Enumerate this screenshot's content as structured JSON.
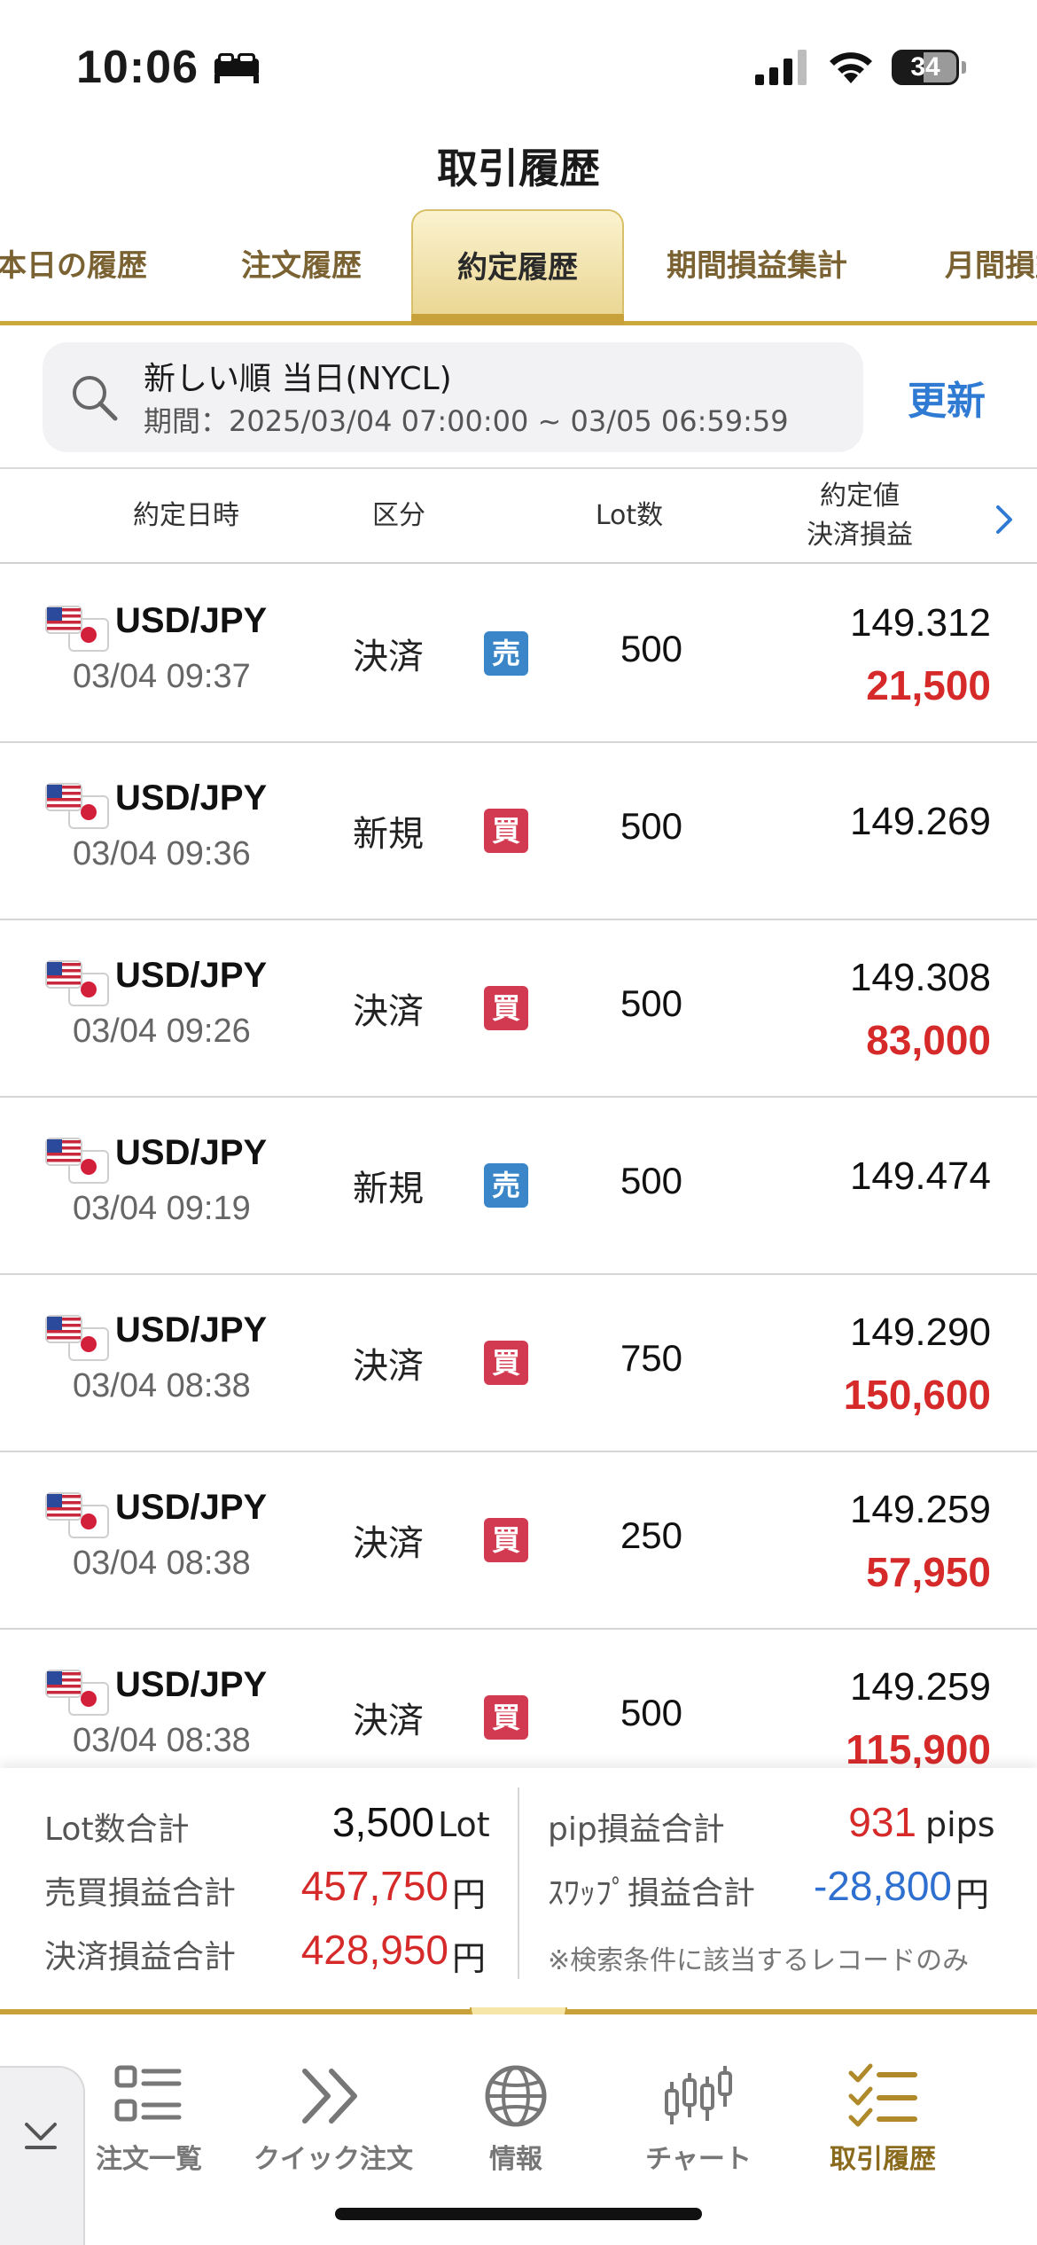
{
  "status_bar": {
    "time": "10:06",
    "battery": "34"
  },
  "page_title": "取引履歴",
  "tabs": [
    {
      "label": "本日の履歴",
      "active": false
    },
    {
      "label": "注文履歴",
      "active": false
    },
    {
      "label": "約定履歴",
      "active": true
    },
    {
      "label": "期間損益集計",
      "active": false
    },
    {
      "label": "月間損益",
      "active": false
    }
  ],
  "search": {
    "line1": "新しい順 当日(NYCL)",
    "line2": "期間：2025/03/04 07:00:00 ~ 03/05 06:59:59",
    "refresh_label": "更新"
  },
  "table": {
    "headers": {
      "datetime": "約定日時",
      "kind": "区分",
      "lot": "Lot数",
      "price_line1": "約定値",
      "price_line2": "決済損益"
    },
    "rows": [
      {
        "pair": "USD/JPY",
        "datetime": "03/04 09:37",
        "kind": "決済",
        "side": "売",
        "side_type": "sell",
        "lot": "500",
        "price": "149.312",
        "pnl": "21,500"
      },
      {
        "pair": "USD/JPY",
        "datetime": "03/04 09:36",
        "kind": "新規",
        "side": "買",
        "side_type": "buy",
        "lot": "500",
        "price": "149.269",
        "pnl": ""
      },
      {
        "pair": "USD/JPY",
        "datetime": "03/04 09:26",
        "kind": "決済",
        "side": "買",
        "side_type": "buy",
        "lot": "500",
        "price": "149.308",
        "pnl": "83,000"
      },
      {
        "pair": "USD/JPY",
        "datetime": "03/04 09:19",
        "kind": "新規",
        "side": "売",
        "side_type": "sell",
        "lot": "500",
        "price": "149.474",
        "pnl": ""
      },
      {
        "pair": "USD/JPY",
        "datetime": "03/04 08:38",
        "kind": "決済",
        "side": "買",
        "side_type": "buy",
        "lot": "750",
        "price": "149.290",
        "pnl": "150,600"
      },
      {
        "pair": "USD/JPY",
        "datetime": "03/04 08:38",
        "kind": "決済",
        "side": "買",
        "side_type": "buy",
        "lot": "250",
        "price": "149.259",
        "pnl": "57,950"
      },
      {
        "pair": "USD/JPY",
        "datetime": "03/04 08:38",
        "kind": "決済",
        "side": "買",
        "side_type": "buy",
        "lot": "500",
        "price": "149.259",
        "pnl": "115,900"
      }
    ]
  },
  "summary": {
    "lot_total_label": "Lot数合計",
    "lot_total_value": "3,500",
    "lot_total_unit": "Lot",
    "trade_pnl_label": "売買損益合計",
    "trade_pnl_value": "457,750",
    "trade_pnl_unit": "円",
    "settle_pnl_label": "決済損益合計",
    "settle_pnl_value": "428,950",
    "settle_pnl_unit": "円",
    "pip_label": "pip損益合計",
    "pip_value": "931",
    "pip_unit": "pips",
    "swap_label": "ｽﾜｯﾌﾟ損益合計",
    "swap_value": "-28,800",
    "swap_unit": "円",
    "note": "※検索条件に該当するレコードのみ"
  },
  "bottom_nav": [
    {
      "label": "注文一覧",
      "icon": "list-icon",
      "active": false
    },
    {
      "label": "クイック注文",
      "icon": "double-chevron-icon",
      "active": false
    },
    {
      "label": "情報",
      "icon": "globe-icon",
      "active": false
    },
    {
      "label": "チャート",
      "icon": "candlestick-icon",
      "active": false
    },
    {
      "label": "取引履歴",
      "icon": "checklist-icon",
      "active": true
    }
  ],
  "colors": {
    "accent_gold": "#c9a13a",
    "sell_blue": "#3a86c8",
    "buy_red": "#d23a52",
    "profit_red": "#d62a2a",
    "loss_blue": "#2f6fd0",
    "refresh_blue": "#2f7ad3"
  }
}
